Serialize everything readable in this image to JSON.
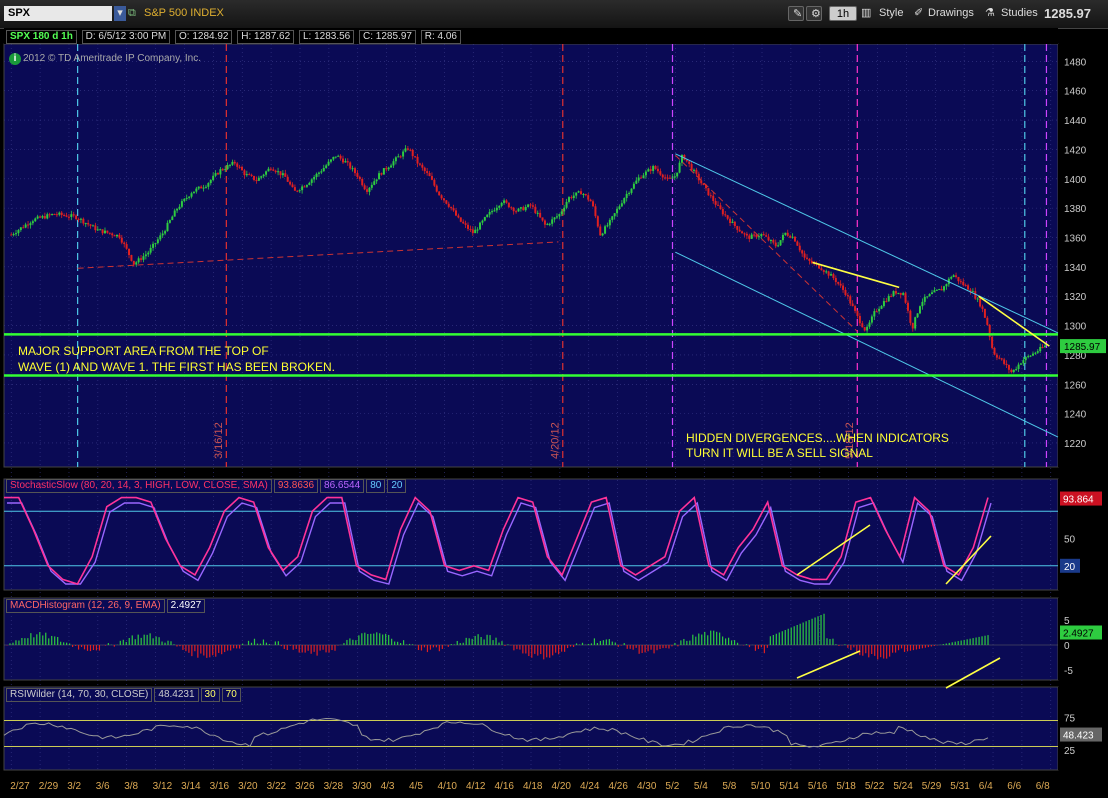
{
  "toolbar": {
    "symbol": "SPX",
    "description": "S&P 500 INDEX",
    "timeframe": "1h",
    "style_label": "Style",
    "drawings_label": "Drawings",
    "studies_label": "Studies",
    "last_price": "1285.97"
  },
  "price_header": {
    "symbol_period": "SPX 180 d 1h",
    "date": "D: 6/5/12 3:00 PM",
    "open": "O: 1284.92",
    "high": "H: 1287.62",
    "low": "L: 1283.56",
    "close": "C: 1285.97",
    "range": "R: 4.06",
    "copyright": "2012 © TD Ameritrade IP Company, Inc."
  },
  "annotations": {
    "support_line1": "MAJOR SUPPORT AREA FROM THE TOP OF",
    "support_line2": "WAVE (1) AND WAVE 1. THE FIRST HAS BEEN BROKEN.",
    "divergence_line1": "HIDDEN DIVERGENCES....WHEN INDICATORS",
    "divergence_line2": "TURN IT WILL BE A SELL SIGNAL",
    "vlabel_1": "3/16/12",
    "vlabel_2": "4/20/12",
    "vlabel_3": "5/18/12"
  },
  "stoch_header": {
    "name": "StochasticSlow (80, 20, 14, 3, HIGH, LOW, CLOSE, SMA)",
    "k": "93.8636",
    "d": "86.6544",
    "ob": "80",
    "os": "20",
    "badge_value": "93.864",
    "badge_20": "20"
  },
  "macd_header": {
    "name": "MACDHistogram (12, 26, 9, EMA)",
    "value": "2.4927",
    "badge_value": "2.4927"
  },
  "rsi_header": {
    "name": "RSIWilder (14, 70, 30, CLOSE)",
    "value": "48.4231",
    "os": "30",
    "ob": "70",
    "badge_value": "48.423"
  },
  "colors": {
    "panel_bg": "#0a0a55",
    "grid": "#3a3a8a",
    "up": "#2ecc40",
    "down": "#e02020",
    "support": "#33ff33",
    "channel": "#4fc8e8",
    "stoch_k": "#ff3399",
    "stoch_d": "#9966ff",
    "trend_yellow": "#ffff44",
    "rsi": "#999999"
  },
  "chart_data": [
    {
      "type": "candlestick",
      "title": "SPX 180 d 1h",
      "ylim": [
        1205,
        1485
      ],
      "y_ticks": [
        1220,
        1240,
        1260,
        1280,
        1300,
        1320,
        1340,
        1360,
        1380,
        1400,
        1420,
        1440,
        1460,
        1480
      ],
      "x_ticks": [
        "2/27",
        "2/29",
        "3/2",
        "3/6",
        "3/8",
        "3/12",
        "3/14",
        "3/16",
        "3/20",
        "3/22",
        "3/26",
        "3/28",
        "3/30",
        "4/3",
        "4/5",
        "4/10",
        "4/12",
        "4/16",
        "4/18",
        "4/20",
        "4/24",
        "4/26",
        "4/30",
        "5/2",
        "5/4",
        "5/8",
        "5/10",
        "5/14",
        "5/16",
        "5/18",
        "5/22",
        "5/24",
        "5/29",
        "5/31",
        "6/4",
        "6/6",
        "6/8"
      ],
      "close_path": [
        [
          0,
          1362
        ],
        [
          1.5,
          1372
        ],
        [
          3,
          1376
        ],
        [
          4.5,
          1374
        ],
        [
          6,
          1365
        ],
        [
          7.5,
          1361
        ],
        [
          8.5,
          1342
        ],
        [
          9.5,
          1350
        ],
        [
          10.5,
          1363
        ],
        [
          11.5,
          1380
        ],
        [
          12.5,
          1391
        ],
        [
          13.5,
          1396
        ],
        [
          14.5,
          1406
        ],
        [
          15.5,
          1411
        ],
        [
          16.2,
          1403
        ],
        [
          17,
          1399
        ],
        [
          18,
          1408
        ],
        [
          19,
          1401
        ],
        [
          19.6,
          1391
        ],
        [
          20.5,
          1397
        ],
        [
          21.5,
          1406
        ],
        [
          22.5,
          1416
        ],
        [
          23.2,
          1411
        ],
        [
          24,
          1402
        ],
        [
          24.6,
          1392
        ],
        [
          25.5,
          1403
        ],
        [
          26.5,
          1412
        ],
        [
          27.5,
          1421
        ],
        [
          28.2,
          1410
        ],
        [
          29,
          1401
        ],
        [
          29.6,
          1390
        ],
        [
          30.4,
          1381
        ],
        [
          31,
          1372
        ],
        [
          32,
          1363
        ],
        [
          33,
          1375
        ],
        [
          34,
          1385
        ],
        [
          35,
          1378
        ],
        [
          36,
          1382
        ],
        [
          37,
          1368
        ],
        [
          38,
          1376
        ],
        [
          38.6,
          1387
        ],
        [
          39.5,
          1391
        ],
        [
          40.2,
          1384
        ],
        [
          40.8,
          1362
        ],
        [
          41.5,
          1371
        ],
        [
          42.5,
          1388
        ],
        [
          43.5,
          1401
        ],
        [
          44.5,
          1408
        ],
        [
          45.5,
          1399
        ],
        [
          46,
          1402
        ],
        [
          46.5,
          1416
        ],
        [
          47.2,
          1406
        ],
        [
          48,
          1394
        ],
        [
          49,
          1380
        ],
        [
          50,
          1369
        ],
        [
          51,
          1360
        ],
        [
          52,
          1362
        ],
        [
          53,
          1354
        ],
        [
          53.6,
          1363
        ],
        [
          54.2,
          1360
        ],
        [
          55,
          1345
        ],
        [
          56,
          1340
        ],
        [
          57,
          1332
        ],
        [
          57.8,
          1322
        ],
        [
          58.6,
          1306
        ],
        [
          59.2,
          1296
        ],
        [
          59.8,
          1309
        ],
        [
          60.5,
          1317
        ],
        [
          61.2,
          1323
        ],
        [
          61.8,
          1322
        ],
        [
          62.4,
          1298
        ],
        [
          63,
          1316
        ],
        [
          63.8,
          1322
        ],
        [
          64.5,
          1325
        ],
        [
          65.2,
          1335
        ],
        [
          65.8,
          1329
        ],
        [
          66.5,
          1324
        ],
        [
          67.2,
          1313
        ],
        [
          67.6,
          1301
        ],
        [
          68,
          1282
        ],
        [
          68.6,
          1276
        ],
        [
          69.3,
          1268
        ],
        [
          70,
          1276
        ],
        [
          70.8,
          1281
        ],
        [
          71.6,
          1286
        ]
      ]
    },
    {
      "type": "line",
      "title": "StochasticSlow (80, 20, 14, 3, HIGH, LOW, CLOSE, SMA)",
      "ylim": [
        0,
        100
      ],
      "levels": [
        80,
        20
      ],
      "series": [
        {
          "name": "SlowK",
          "last": 93.8636
        },
        {
          "name": "SlowD",
          "last": 86.6544
        }
      ]
    },
    {
      "type": "bar",
      "title": "MACDHistogram (12, 26, 9, EMA)",
      "ylim": [
        -5,
        5
      ],
      "y_ticks": [
        5,
        0,
        -5
      ],
      "last": 2.4927
    },
    {
      "type": "line",
      "title": "RSIWilder (14, 70, 30, CLOSE)",
      "ylim": [
        0,
        100
      ],
      "levels": [
        70,
        30
      ],
      "y_ticks": [
        75,
        25
      ],
      "last": 48.4231
    }
  ]
}
